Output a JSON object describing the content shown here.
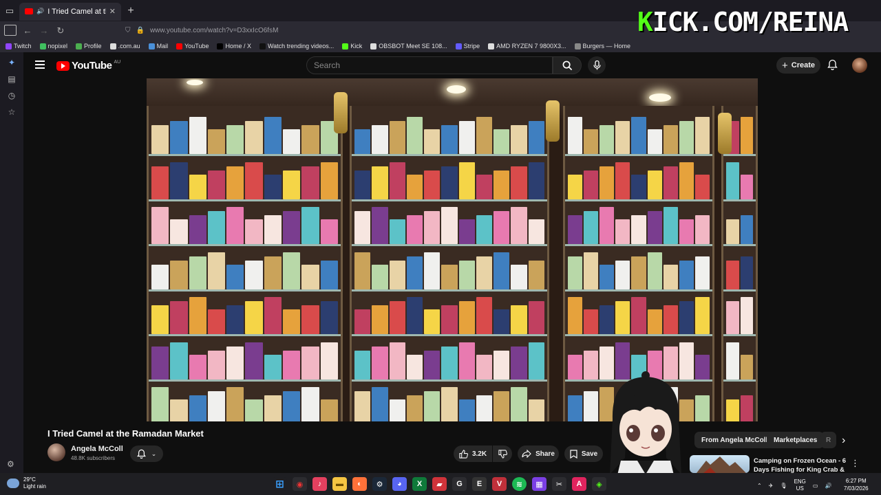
{
  "browser": {
    "tab_title": "I Tried Camel at the Ramadan Market",
    "url": "www.youtube.com/watch?v=D3xxIcO6fsM",
    "new_tab_icon": "plus-icon"
  },
  "bookmarks": [
    {
      "label": "Twitch",
      "color": "#9146ff"
    },
    {
      "label": "nopixel",
      "color": "#3fbf5f"
    },
    {
      "label": "Profile",
      "color": "#4caf50"
    },
    {
      "label": ".com.au",
      "color": "#dddddd"
    },
    {
      "label": "Mail",
      "color": "#4a90d9"
    },
    {
      "label": "YouTube",
      "color": "#ff0000"
    },
    {
      "label": "Home / X",
      "color": "#000000"
    },
    {
      "label": "Watch trending videos...",
      "color": "#111111"
    },
    {
      "label": "Kick",
      "color": "#53fc18"
    },
    {
      "label": "OBSBOT Meet SE 108...",
      "color": "#dddddd"
    },
    {
      "label": "Stripe",
      "color": "#635bff"
    },
    {
      "label": "AMD RYZEN 7 9800X3...",
      "color": "#dddddd"
    },
    {
      "label": "Burgers — Home",
      "color": "#888888"
    }
  ],
  "overlay": {
    "kick_letter": "K",
    "kick_rest": "ICK.COM/REINA"
  },
  "youtube": {
    "logo_text": "YouTube",
    "region": "AU",
    "search_placeholder": "Search",
    "create_label": "Create"
  },
  "video": {
    "title": "I Tried Camel at the Ramadan Market",
    "channel_name": "Angela McColl",
    "subscribers": "48.8K subscribers",
    "likes": "3.2K",
    "share_label": "Share",
    "save_label": "Save"
  },
  "chips": [
    "From Angela McColl",
    "Marketplaces",
    "R"
  ],
  "recommendation": {
    "title": "Camping on Frozen Ocean - 6 Days Fishing for King Crab & ..."
  },
  "taskbar": {
    "temperature": "29°C",
    "condition": "Light rain",
    "lang_top": "ENG",
    "lang_bottom": "US",
    "time": "6:27 PM",
    "date": "7/03/2026"
  }
}
